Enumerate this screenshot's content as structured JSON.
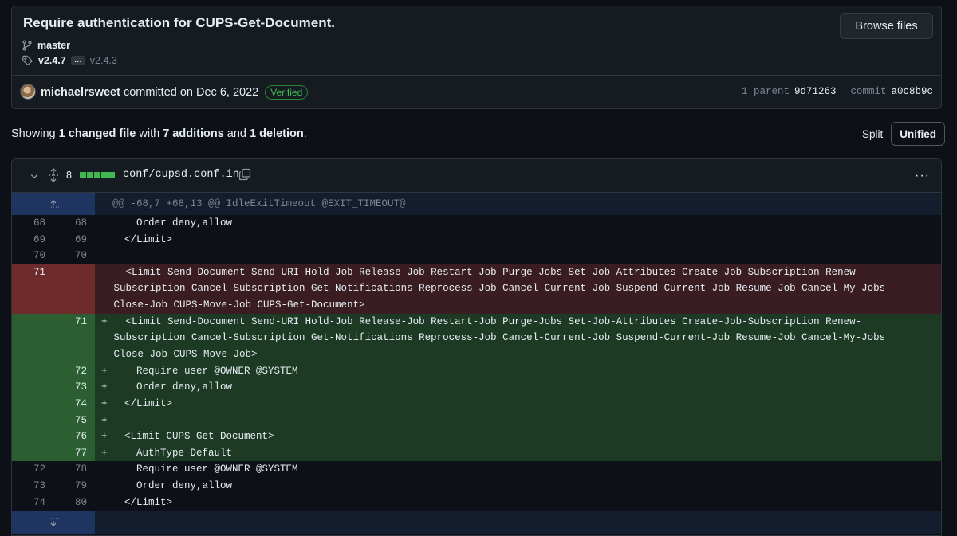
{
  "commit": {
    "title": "Require authentication for CUPS-Get-Document.",
    "browse_label": "Browse files",
    "branch": "master",
    "tag": "v2.4.7",
    "tag_ellipsis": "…",
    "tag_other": "v2.4.3",
    "author": "michaelrsweet",
    "committed_text": "committed on Dec 6, 2022",
    "verified": "Verified",
    "parent_label": "1 parent",
    "parent_sha": "9d71263",
    "commit_label": "commit",
    "commit_sha": "a0c8b9c"
  },
  "summary": {
    "prefix": "Showing",
    "files": "1 changed file",
    "with": "with",
    "additions": "7 additions",
    "and": "and",
    "deletions": "1 deletion",
    "suffix": "."
  },
  "view_toggle": {
    "split": "Split",
    "unified": "Unified"
  },
  "file": {
    "change_count": "8",
    "path": "conf/cupsd.conf.in",
    "menu": "···"
  },
  "hunk_header": "@@ -68,7 +68,13 @@ IdleExitTimeout @EXIT_TIMEOUT@",
  "lines": [
    {
      "old": "68",
      "new": "68",
      "sign": "",
      "text": "    Order deny,allow"
    },
    {
      "old": "69",
      "new": "69",
      "sign": "",
      "text": "  </Limit>"
    },
    {
      "old": "70",
      "new": "70",
      "sign": "",
      "text": ""
    }
  ],
  "deleted": {
    "old": "71",
    "sign": "-",
    "text": "  <Limit Send-Document Send-URI Hold-Job Release-Job Restart-Job Purge-Jobs Set-Job-Attributes Create-Job-Subscription Renew-Subscription Cancel-Subscription Get-Notifications Reprocess-Job Cancel-Current-Job Suspend-Current-Job Resume-Job Cancel-My-Jobs Close-Job CUPS-Move-Job CUPS-Get-Document>"
  },
  "added_first": {
    "new": "71",
    "sign": "+",
    "text": "  <Limit Send-Document Send-URI Hold-Job Release-Job Restart-Job Purge-Jobs Set-Job-Attributes Create-Job-Subscription Renew-Subscription Cancel-Subscription Get-Notifications Reprocess-Job Cancel-Current-Job Suspend-Current-Job Resume-Job Cancel-My-Jobs Close-Job CUPS-Move-Job>"
  },
  "added": [
    {
      "new": "72",
      "sign": "+",
      "text": "    Require user @OWNER @SYSTEM"
    },
    {
      "new": "73",
      "sign": "+",
      "text": "    Order deny,allow"
    },
    {
      "new": "74",
      "sign": "+",
      "text": "  </Limit>"
    },
    {
      "new": "75",
      "sign": "+",
      "text": ""
    },
    {
      "new": "76",
      "sign": "+",
      "text": "  <Limit CUPS-Get-Document>"
    },
    {
      "new": "77",
      "sign": "+",
      "text": "    AuthType Default"
    }
  ],
  "tail": [
    {
      "old": "72",
      "new": "78",
      "sign": "",
      "text": "    Require user @OWNER @SYSTEM"
    },
    {
      "old": "73",
      "new": "79",
      "sign": "",
      "text": "    Order deny,allow"
    },
    {
      "old": "74",
      "new": "80",
      "sign": "",
      "text": "  </Limit>"
    }
  ]
}
